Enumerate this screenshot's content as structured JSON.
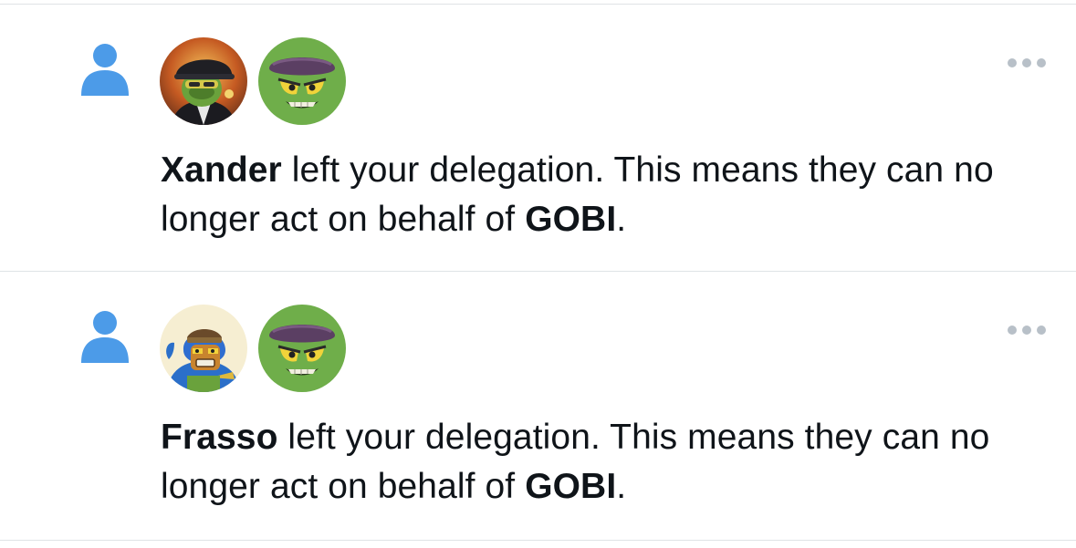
{
  "colors": {
    "accent": "#4c9be8",
    "divider": "#dfe3e6",
    "text": "#0f1419",
    "more_dots": "#b8c0c8"
  },
  "notifications": [
    {
      "actor_name": "Xander",
      "text_middle": " left your delegation. This means they can no longer act on behalf of ",
      "account_name": "GOBI",
      "text_end": ".",
      "icon": "person-icon",
      "actor_avatar": "xander-avatar",
      "account_avatar": "gobi-avatar",
      "menu_icon": "more-icon"
    },
    {
      "actor_name": "Frasso",
      "text_middle": " left your delegation. This means they can no longer act on behalf of ",
      "account_name": "GOBI",
      "text_end": ".",
      "icon": "person-icon",
      "actor_avatar": "frasso-avatar",
      "account_avatar": "gobi-avatar",
      "menu_icon": "more-icon"
    }
  ]
}
